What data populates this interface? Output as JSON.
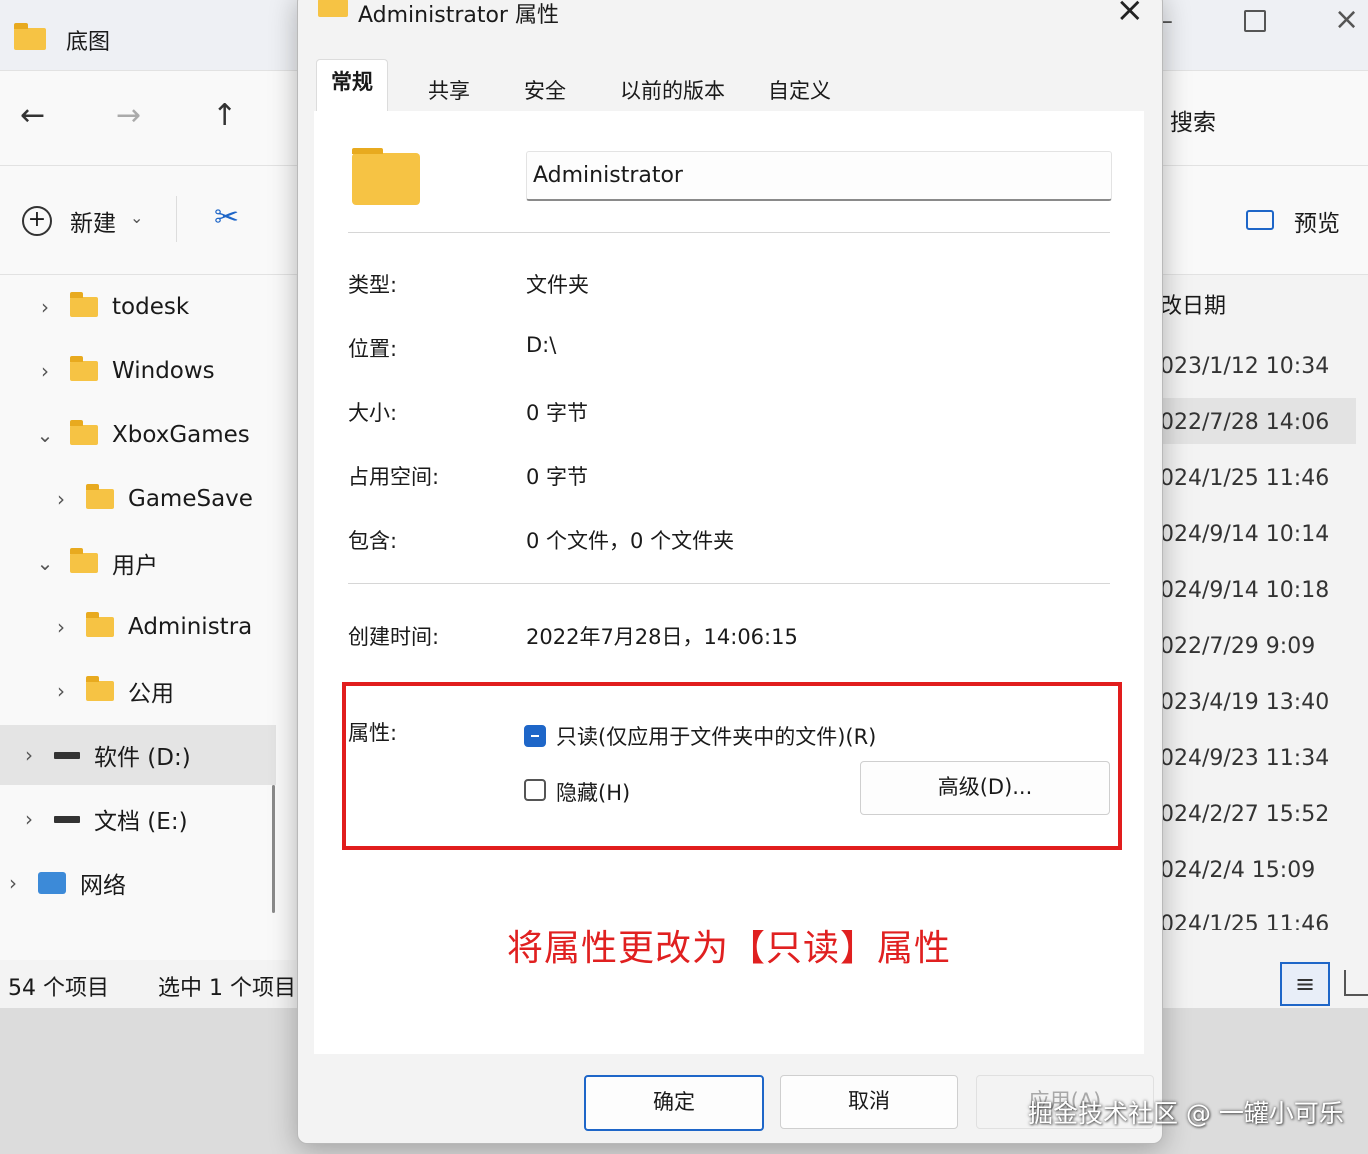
{
  "explorer": {
    "title": "底图",
    "search_fragment": "搜索",
    "new_label": "新建",
    "preview_label": "预览",
    "column_fragment": "改日期",
    "tree": [
      {
        "label": "todesk",
        "chevron": "›",
        "type": "folder",
        "indent": 0
      },
      {
        "label": "Windows",
        "chevron": "›",
        "type": "folder",
        "indent": 0
      },
      {
        "label": "XboxGames",
        "chevron": "⌄",
        "type": "folder",
        "indent": 0
      },
      {
        "label": "GameSave",
        "chevron": "›",
        "type": "folder",
        "indent": 1
      },
      {
        "label": "用户",
        "chevron": "⌄",
        "type": "folder",
        "indent": 0
      },
      {
        "label": "Administra",
        "chevron": "›",
        "type": "folder",
        "indent": 1
      },
      {
        "label": "公用",
        "chevron": "›",
        "type": "folder",
        "indent": 1
      },
      {
        "label": "软件 (D:)",
        "chevron": "›",
        "type": "drive",
        "indent": -1
      },
      {
        "label": "文档 (E:)",
        "chevron": "›",
        "type": "drive",
        "indent": -1
      },
      {
        "label": "网络",
        "chevron": "›",
        "type": "network",
        "indent": -2
      }
    ],
    "dates": [
      "023/1/12 10:34",
      "022/7/28 14:06",
      "024/1/25 11:46",
      "024/9/14 10:14",
      "024/9/14 10:18",
      "022/7/29 9:09",
      "023/4/19 13:40",
      "024/9/23 11:34",
      "024/2/27 15:52",
      "024/2/4 15:09",
      "024/1/25 11:46"
    ],
    "status_count": "54 个项目",
    "status_selected": "选中 1 个项目"
  },
  "dialog": {
    "title": "Administrator 属性",
    "tabs": [
      "常规",
      "共享",
      "安全",
      "以前的版本",
      "自定义"
    ],
    "name": "Administrator",
    "props": [
      {
        "label": "类型:",
        "value": "文件夹"
      },
      {
        "label": "位置:",
        "value": "D:\\"
      },
      {
        "label": "大小:",
        "value": "0 字节"
      },
      {
        "label": "占用空间:",
        "value": "0 字节"
      },
      {
        "label": "包含:",
        "value": "0 个文件，0 个文件夹"
      }
    ],
    "created_label": "创建时间:",
    "created_value": "2022年7月28日，14:06:15",
    "attributes_label": "属性:",
    "readonly_label": "只读(仅应用于文件夹中的文件)(R)",
    "hidden_label": "隐藏(H)",
    "advanced_label": "高级(D)...",
    "annotation": "将属性更改为【只读】属性",
    "ok_label": "确定",
    "cancel_label": "取消",
    "apply_label": "应用(A)"
  },
  "watermark": "掘金技术社区 @ 一罐小可乐",
  "colors": {
    "accent": "#1e66c8",
    "highlight": "#e11d1d",
    "folder": "#f6c344"
  }
}
